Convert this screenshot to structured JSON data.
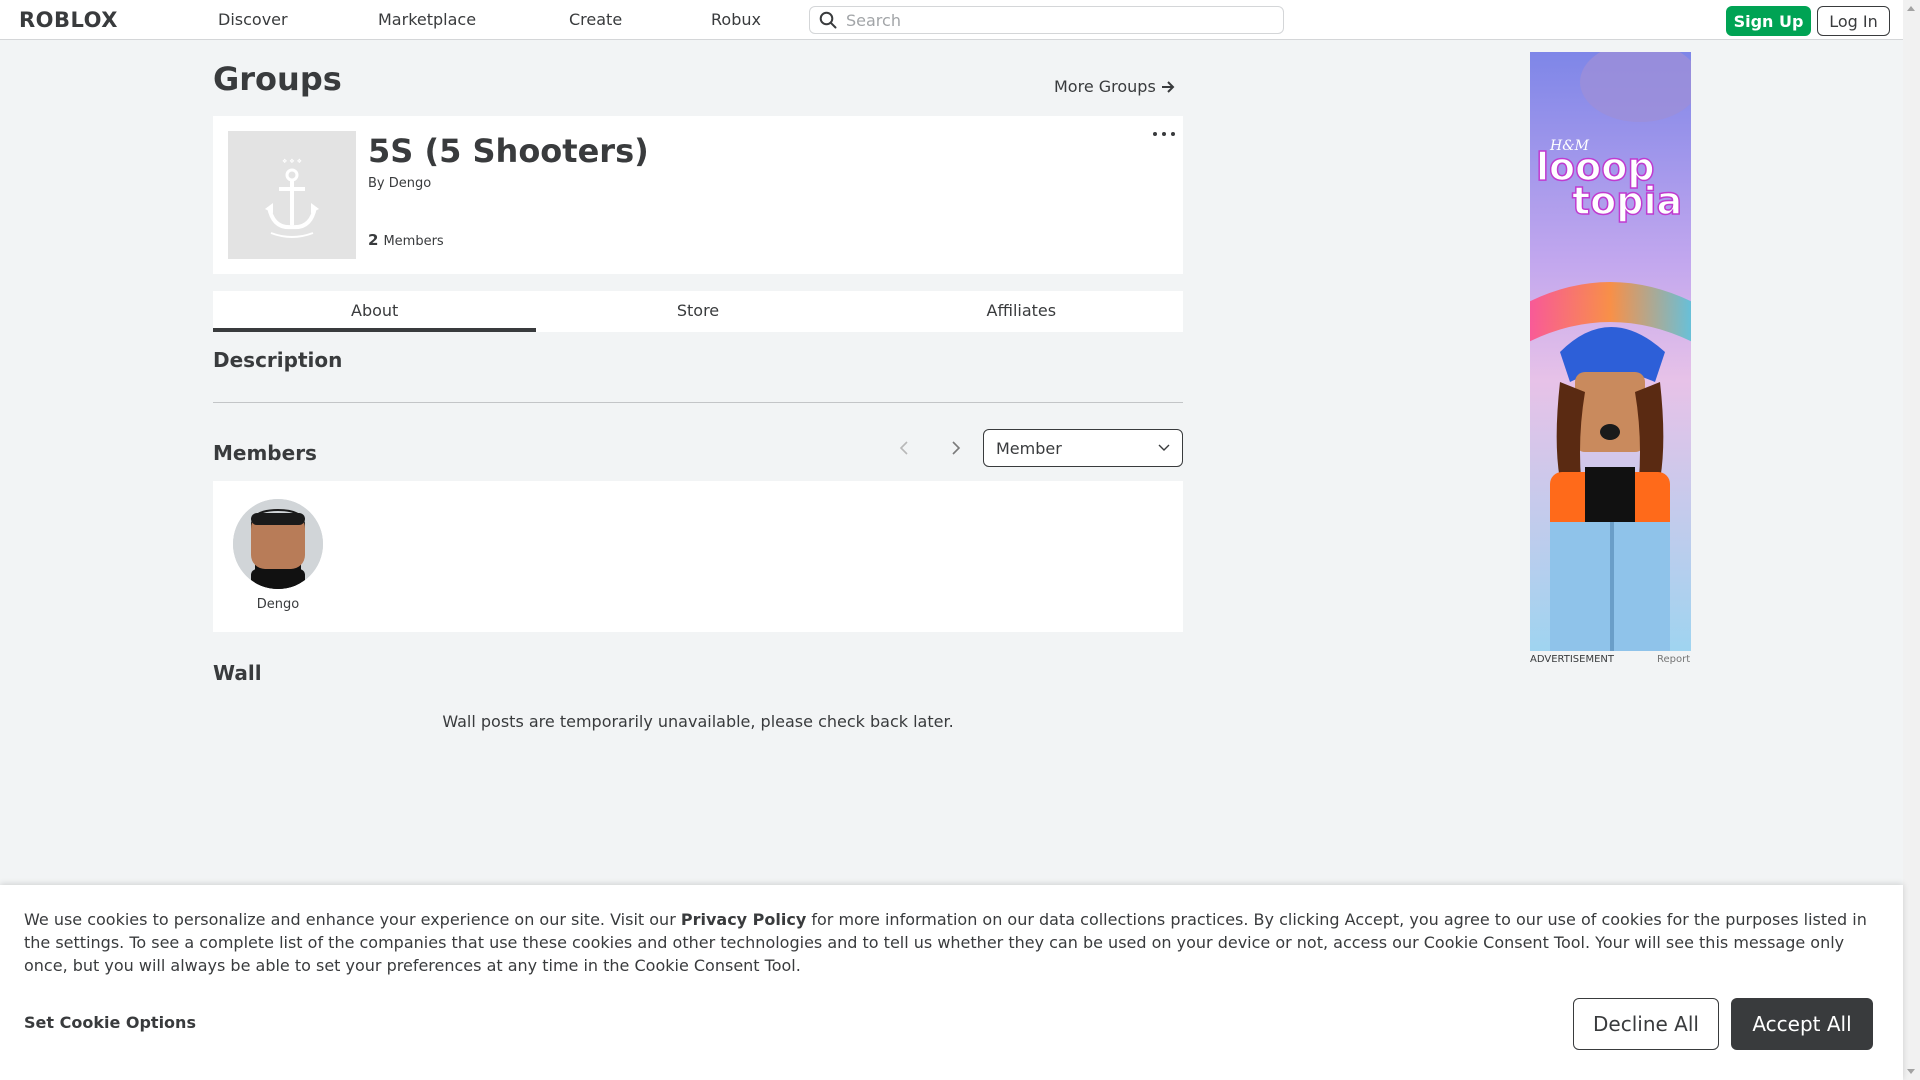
{
  "nav": {
    "logo": "ROBLOX",
    "links": [
      "Discover",
      "Marketplace",
      "Create",
      "Robux"
    ],
    "search_placeholder": "Search",
    "signup_label": "Sign Up",
    "login_label": "Log In"
  },
  "page": {
    "title": "Groups",
    "more_groups_label": "More Groups"
  },
  "group": {
    "name": "5S (5 Shooters)",
    "by_prefix": "By",
    "owner": "Dengo",
    "member_count": "2",
    "member_label": "Members",
    "emblem_icon": "anchor-icon"
  },
  "tabs": [
    "About",
    "Store",
    "Affiliates"
  ],
  "active_tab": "About",
  "sections": {
    "description_title": "Description",
    "members_title": "Members",
    "wall_title": "Wall"
  },
  "members": {
    "role_selected": "Member",
    "list": [
      {
        "name": "Dengo"
      }
    ]
  },
  "wall": {
    "message": "Wall posts are temporarily unavailable, please check back later."
  },
  "ad": {
    "label": "ADVERTISEMENT",
    "report": "Report",
    "brand": "H&M",
    "headline_1": "looop",
    "headline_2": "topia"
  },
  "cookie": {
    "text_1": "We use cookies to personalize and enhance your experience on our site. Visit our ",
    "privacy_link": "Privacy Policy",
    "text_2": " for more information on our data collections practices. By clicking Accept, you agree to our use of cookies for the purposes listed in the settings. To see a complete list of the companies that use these cookies and other technologies and to tell us whether they can be used on your device or not, access our Cookie Consent Tool. Your will see this message only once, but you will always be able to set your preferences at any time in the Cookie Consent Tool.",
    "options_label": "Set Cookie Options",
    "decline_label": "Decline All",
    "accept_label": "Accept All"
  },
  "colors": {
    "accent_green": "#00a354",
    "text_primary": "#393b3d",
    "page_bg": "#f2f4f5"
  }
}
